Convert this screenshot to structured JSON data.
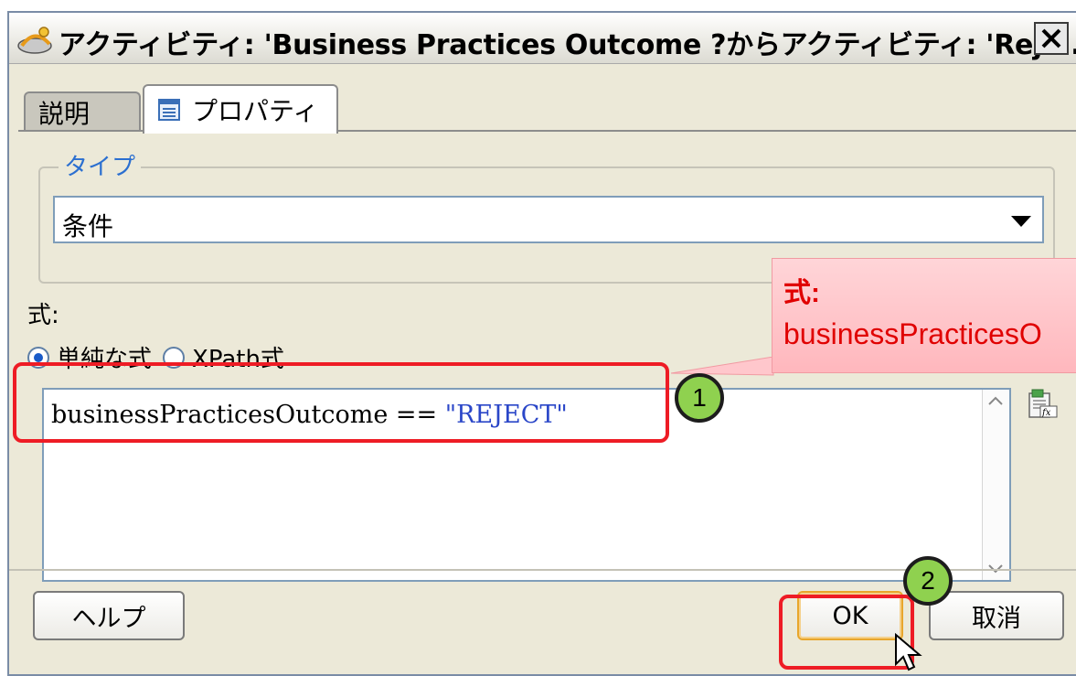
{
  "dialog": {
    "title": "アクティビティ: 'Business Practices Outcome ?からアクティビティ: 'Reje...",
    "close_icon": "close-icon"
  },
  "tabs": [
    {
      "label": "説明",
      "active": false
    },
    {
      "label": "プロパティ",
      "active": true,
      "icon": "properties-icon"
    }
  ],
  "type_group": {
    "label": "タイプ",
    "selected": "条件"
  },
  "expression": {
    "label": "式:",
    "radios": [
      {
        "label": "単純な式",
        "checked": true
      },
      {
        "label": "XPath式",
        "checked": false
      }
    ],
    "code_identifier": "businessPracticesOutcome",
    "code_operator": " == ",
    "code_string": "\"REJECT\""
  },
  "buttons": {
    "help": "ヘルプ",
    "ok": "OK",
    "cancel": "取消"
  },
  "annotations": {
    "callout_title": "式:",
    "callout_text": "businessPracticesO",
    "step1": "1",
    "step2": "2",
    "highlight_color": "#ee1c25",
    "step_color": "#8fd14f"
  }
}
